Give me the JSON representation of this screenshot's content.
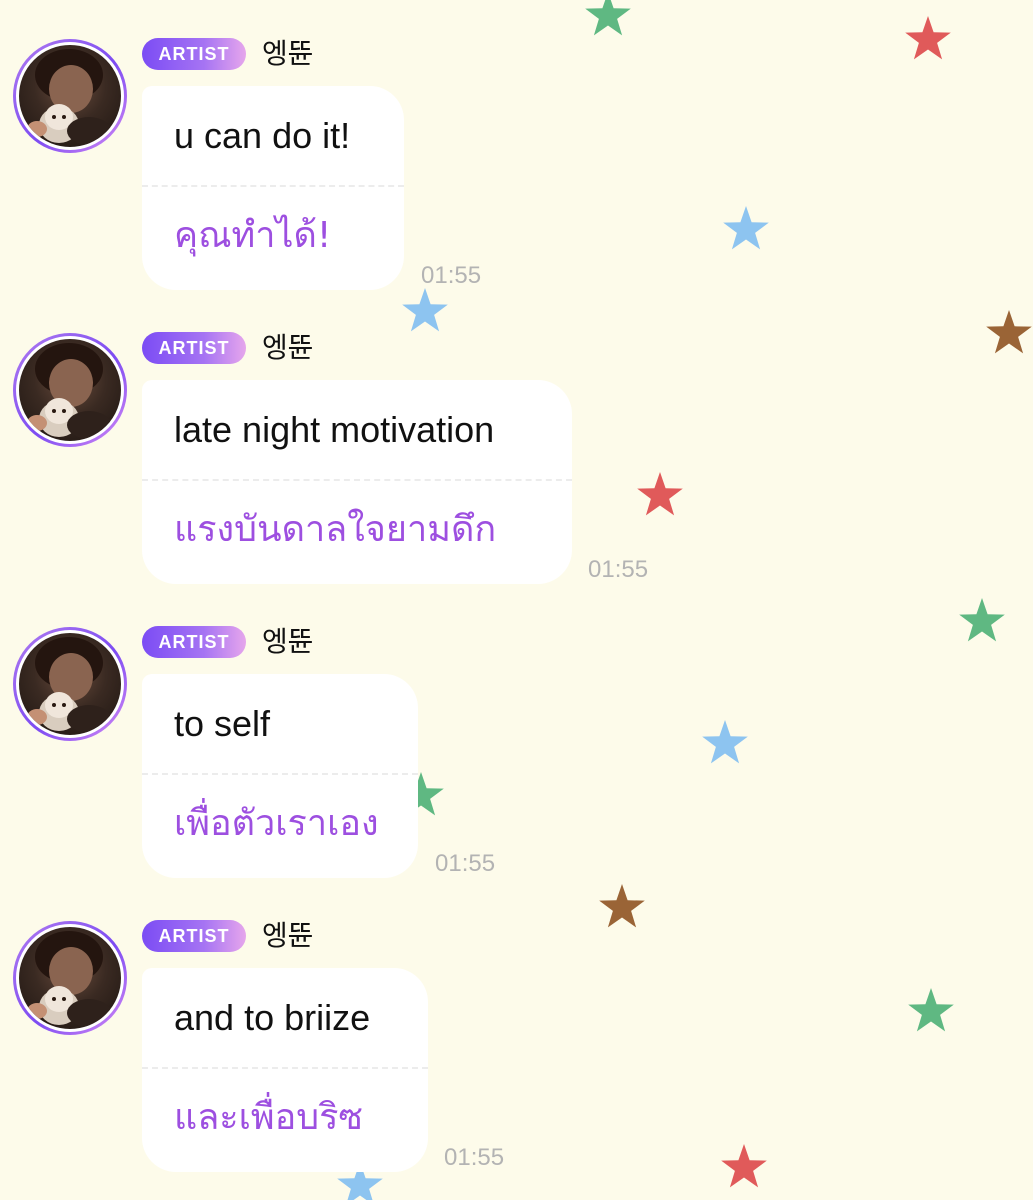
{
  "theme": {
    "background": "#fdfbea",
    "accent_purple": "#9d4fe0",
    "badge_gradient": [
      "#7b4cf4",
      "#e6a6ec"
    ],
    "star_colors": [
      "#5fb882",
      "#e05a5a",
      "#8dc4f0",
      "#9a6436"
    ]
  },
  "messages": [
    {
      "badge": "ARTIST",
      "username": "엥뜐",
      "original": "u can do it!",
      "translation": "คุณทำได้!",
      "time": "01:55"
    },
    {
      "badge": "ARTIST",
      "username": "엥뜐",
      "original": "late night motivation",
      "translation": "แรงบันดาลใจยามดึก",
      "time": "01:55"
    },
    {
      "badge": "ARTIST",
      "username": "엥뜐",
      "original": "to self",
      "translation": "เพื่อตัวเราเอง",
      "time": "01:55"
    },
    {
      "badge": "ARTIST",
      "username": "엥뜐",
      "original": "and to briize",
      "translation": "และเพื่อบริซ",
      "time": "01:55"
    }
  ]
}
